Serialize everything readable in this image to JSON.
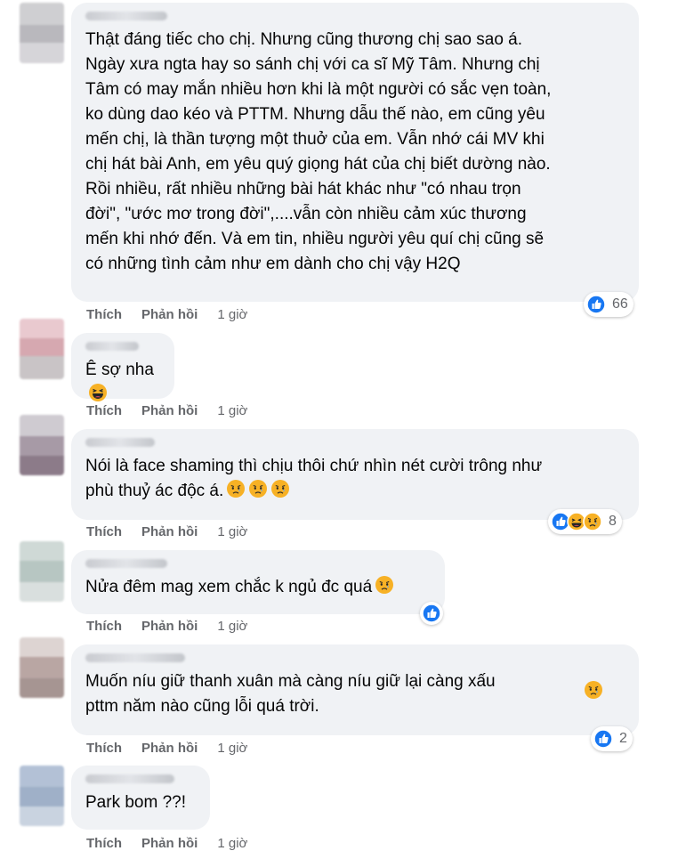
{
  "actions": {
    "like": "Thích",
    "reply": "Phản hồi"
  },
  "comments": [
    {
      "text": "Thật đáng tiếc cho chị. Nhưng cũng thương chị sao sao á.\nNgày xưa ngta hay so sánh chị với ca sĩ Mỹ Tâm. Nhưng chị\nTâm có may mắn nhiều hơn khi là một người có sắc vẹn toàn,\nko dùng dao kéo và PTTM. Nhưng dẫu thế nào, em cũng yêu\nmến chị, là thần tượng một thuở của em. Vẫn nhớ cái MV khi\nchị hát bài Anh, em yêu quý giọng hát của chị biết dường nào.\nRồi nhiều, rất nhiều những bài hát khác như \"có nhau trọn\nđời\", \"ước mơ trong đời\",....vẫn còn nhiều cảm xúc thương\nmến khi nhớ đến. Và em tin, nhiều người yêu quí chị cũng sẽ\ncó những tình cảm như em dành cho chị vậy H2Q",
      "time": "1 giờ",
      "reaction_count": "66",
      "reactions": [
        "like-icon"
      ]
    },
    {
      "text": "Ê sợ nha",
      "emoji": [
        "laughing-emoji-icon"
      ],
      "time": "1 giờ"
    },
    {
      "text": "Nói là face shaming thì chịu thôi chứ nhìn nét cười trông như\nphù thuỷ ác độc á.",
      "emoji": [
        "sad-emoji-icon",
        "sad-emoji-icon",
        "sad-emoji-icon"
      ],
      "time": "1 giờ",
      "reaction_count": "8",
      "reactions": [
        "like-icon",
        "haha-icon",
        "sad-icon"
      ]
    },
    {
      "text": "Nửa đêm mag xem chắc k ngủ đc quá",
      "emoji": [
        "sad-emoji-icon"
      ],
      "time": "1 giờ",
      "reactions": [
        "like-icon"
      ]
    },
    {
      "text": "Muốn níu giữ thanh xuân mà càng níu giữ lại càng xấu\npttm năm nào cũng lỗi quá trời.",
      "emoji_line1": [
        "sad-emoji-icon"
      ],
      "time": "1 giờ",
      "reaction_count": "2",
      "reactions": [
        "like-icon"
      ]
    },
    {
      "text": "Park bom ??!",
      "time": "1 giờ"
    }
  ],
  "colors": {
    "bubble": "#f0f2f5",
    "action_text": "#65676b",
    "like_blue": "#1877f2",
    "emoji_yellow": "#f7b125"
  }
}
